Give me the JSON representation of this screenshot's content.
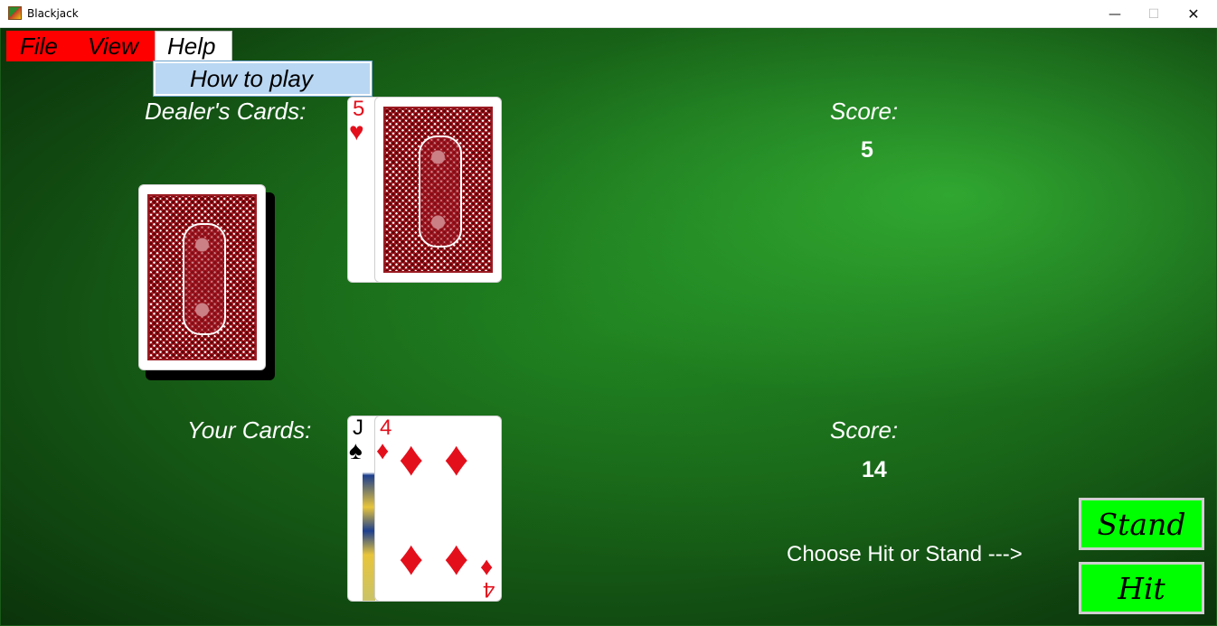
{
  "window": {
    "title": "Blackjack",
    "minimize_glyph": "—",
    "maximize_glyph": "☐",
    "close_glyph": "✕"
  },
  "menu": {
    "file": "File",
    "view": "View",
    "help": "Help",
    "help_dropdown": [
      "How to play"
    ]
  },
  "dealer": {
    "label": "Dealer's Cards:",
    "score_label": "Score:",
    "score": "5",
    "cards": [
      {
        "rank": "5",
        "suit": "♥",
        "face": "up"
      },
      {
        "face": "down"
      }
    ]
  },
  "player": {
    "label": "Your Cards:",
    "score_label": "Score:",
    "score": "14",
    "cards": [
      {
        "rank": "J",
        "suit": "♠"
      },
      {
        "rank": "4",
        "suit": "♦"
      }
    ]
  },
  "status": "Choose Hit or Stand --->",
  "buttons": {
    "stand": "Stand",
    "hit": "Hit"
  },
  "colors": {
    "felt": "#1e7a1e",
    "menu_red": "#ff0000",
    "button_green": "#00ff00",
    "card_back": "#a01822",
    "suit_red": "#e3101c"
  },
  "icons": {
    "app": "blackjack-app-icon",
    "deck": "card-deck-icon"
  }
}
